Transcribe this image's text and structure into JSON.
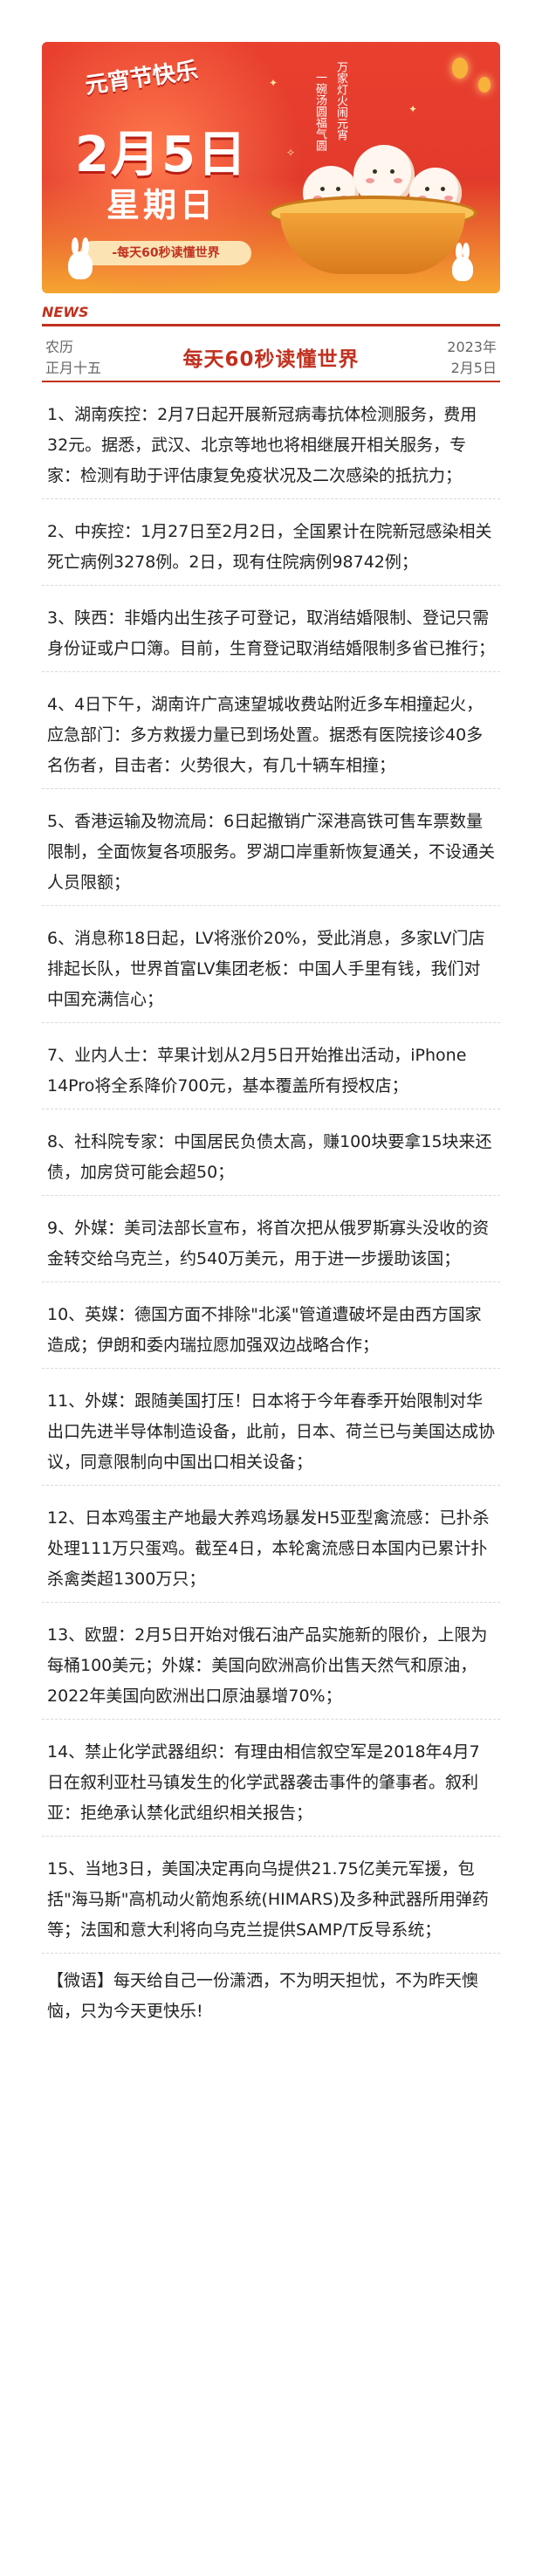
{
  "banner": {
    "calligraphy": "元宵节快乐",
    "date": "2月5日",
    "weekday": "星期日",
    "tagline": "-每天60秒读懂世界",
    "vertical_1": "万家灯火闹元宵",
    "vertical_2": "一碗汤圆福气圆"
  },
  "header": {
    "news_label": "NEWS",
    "lunar_line1": "农历",
    "lunar_line2": "正月十五",
    "title": "每天60秒读懂世界",
    "year": "2023年",
    "date": "2月5日"
  },
  "items": [
    "1、湖南疾控：2月7日起开展新冠病毒抗体检测服务，费用32元。据悉，武汉、北京等地也将相继展开相关服务，专家：检测有助于评估康复免疫状况及二次感染的抵抗力；",
    "2、中疾控：1月27日至2月2日，全国累计在院新冠感染相关死亡病例3278例。2日，现有住院病例98742例；",
    "3、陕西：非婚内出生孩子可登记，取消结婚限制、登记只需身份证或户口簿。目前，生育登记取消结婚限制多省已推行；",
    "4、4日下午，湖南许广高速望城收费站附近多车相撞起火，应急部门：多方救援力量已到场处置。据悉有医院接诊40多名伤者，目击者：火势很大，有几十辆车相撞；",
    "5、香港运输及物流局：6日起撤销广深港高铁可售车票数量限制，全面恢复各项服务。罗湖口岸重新恢复通关，不设通关人员限额；",
    "6、消息称18日起，LV将涨价20%，受此消息，多家LV门店排起长队，世界首富LV集团老板：中国人手里有钱，我们对中国充满信心；",
    "7、业内人士：苹果计划从2月5日开始推出活动，iPhone 14Pro将全系降价700元，基本覆盖所有授权店；",
    "8、社科院专家：中国居民负债太高，赚100块要拿15块来还债，加房贷可能会超50；",
    "9、外媒：美司法部长宣布，将首次把从俄罗斯寡头没收的资金转交给乌克兰，约540万美元，用于进一步援助该国；",
    "10、英媒：德国方面不排除\"北溪\"管道遭破坏是由西方国家造成；伊朗和委内瑞拉愿加强双边战略合作；",
    "11、外媒：跟随美国打压！日本将于今年春季开始限制对华出口先进半导体制造设备，此前，日本、荷兰已与美国达成协议，同意限制向中国出口相关设备；",
    "12、日本鸡蛋主产地最大养鸡场暴发H5亚型禽流感：已扑杀处理111万只蛋鸡。截至4日，本轮禽流感日本国内已累计扑杀禽类超1300万只；",
    "13、欧盟：2月5日开始对俄石油产品实施新的限价，上限为每桶100美元；外媒：美国向欧洲高价出售天然气和原油，2022年美国向欧洲出口原油暴增70%；",
    "14、禁止化学武器组织：有理由相信叙空军是2018年4月7日在叙利亚杜马镇发生的化学武器袭击事件的肇事者。叙利亚：拒绝承认禁化武组织相关报告；",
    "15、当地3日，美国决定再向乌提供21.75亿美元军援，包括\"海马斯\"高机动火箭炮系统(HIMARS)及多种武器所用弹药等；法国和意大利将向乌克兰提供SAMP/T反导系统；"
  ],
  "quote": "【微语】每天给自己一份潇洒，不为明天担忧，不为昨天懊恼，只为今天更快乐!",
  "colors": {
    "accent": "#c1311f",
    "banner_red": "#e23a2c",
    "banner_gold": "#f5a531"
  }
}
